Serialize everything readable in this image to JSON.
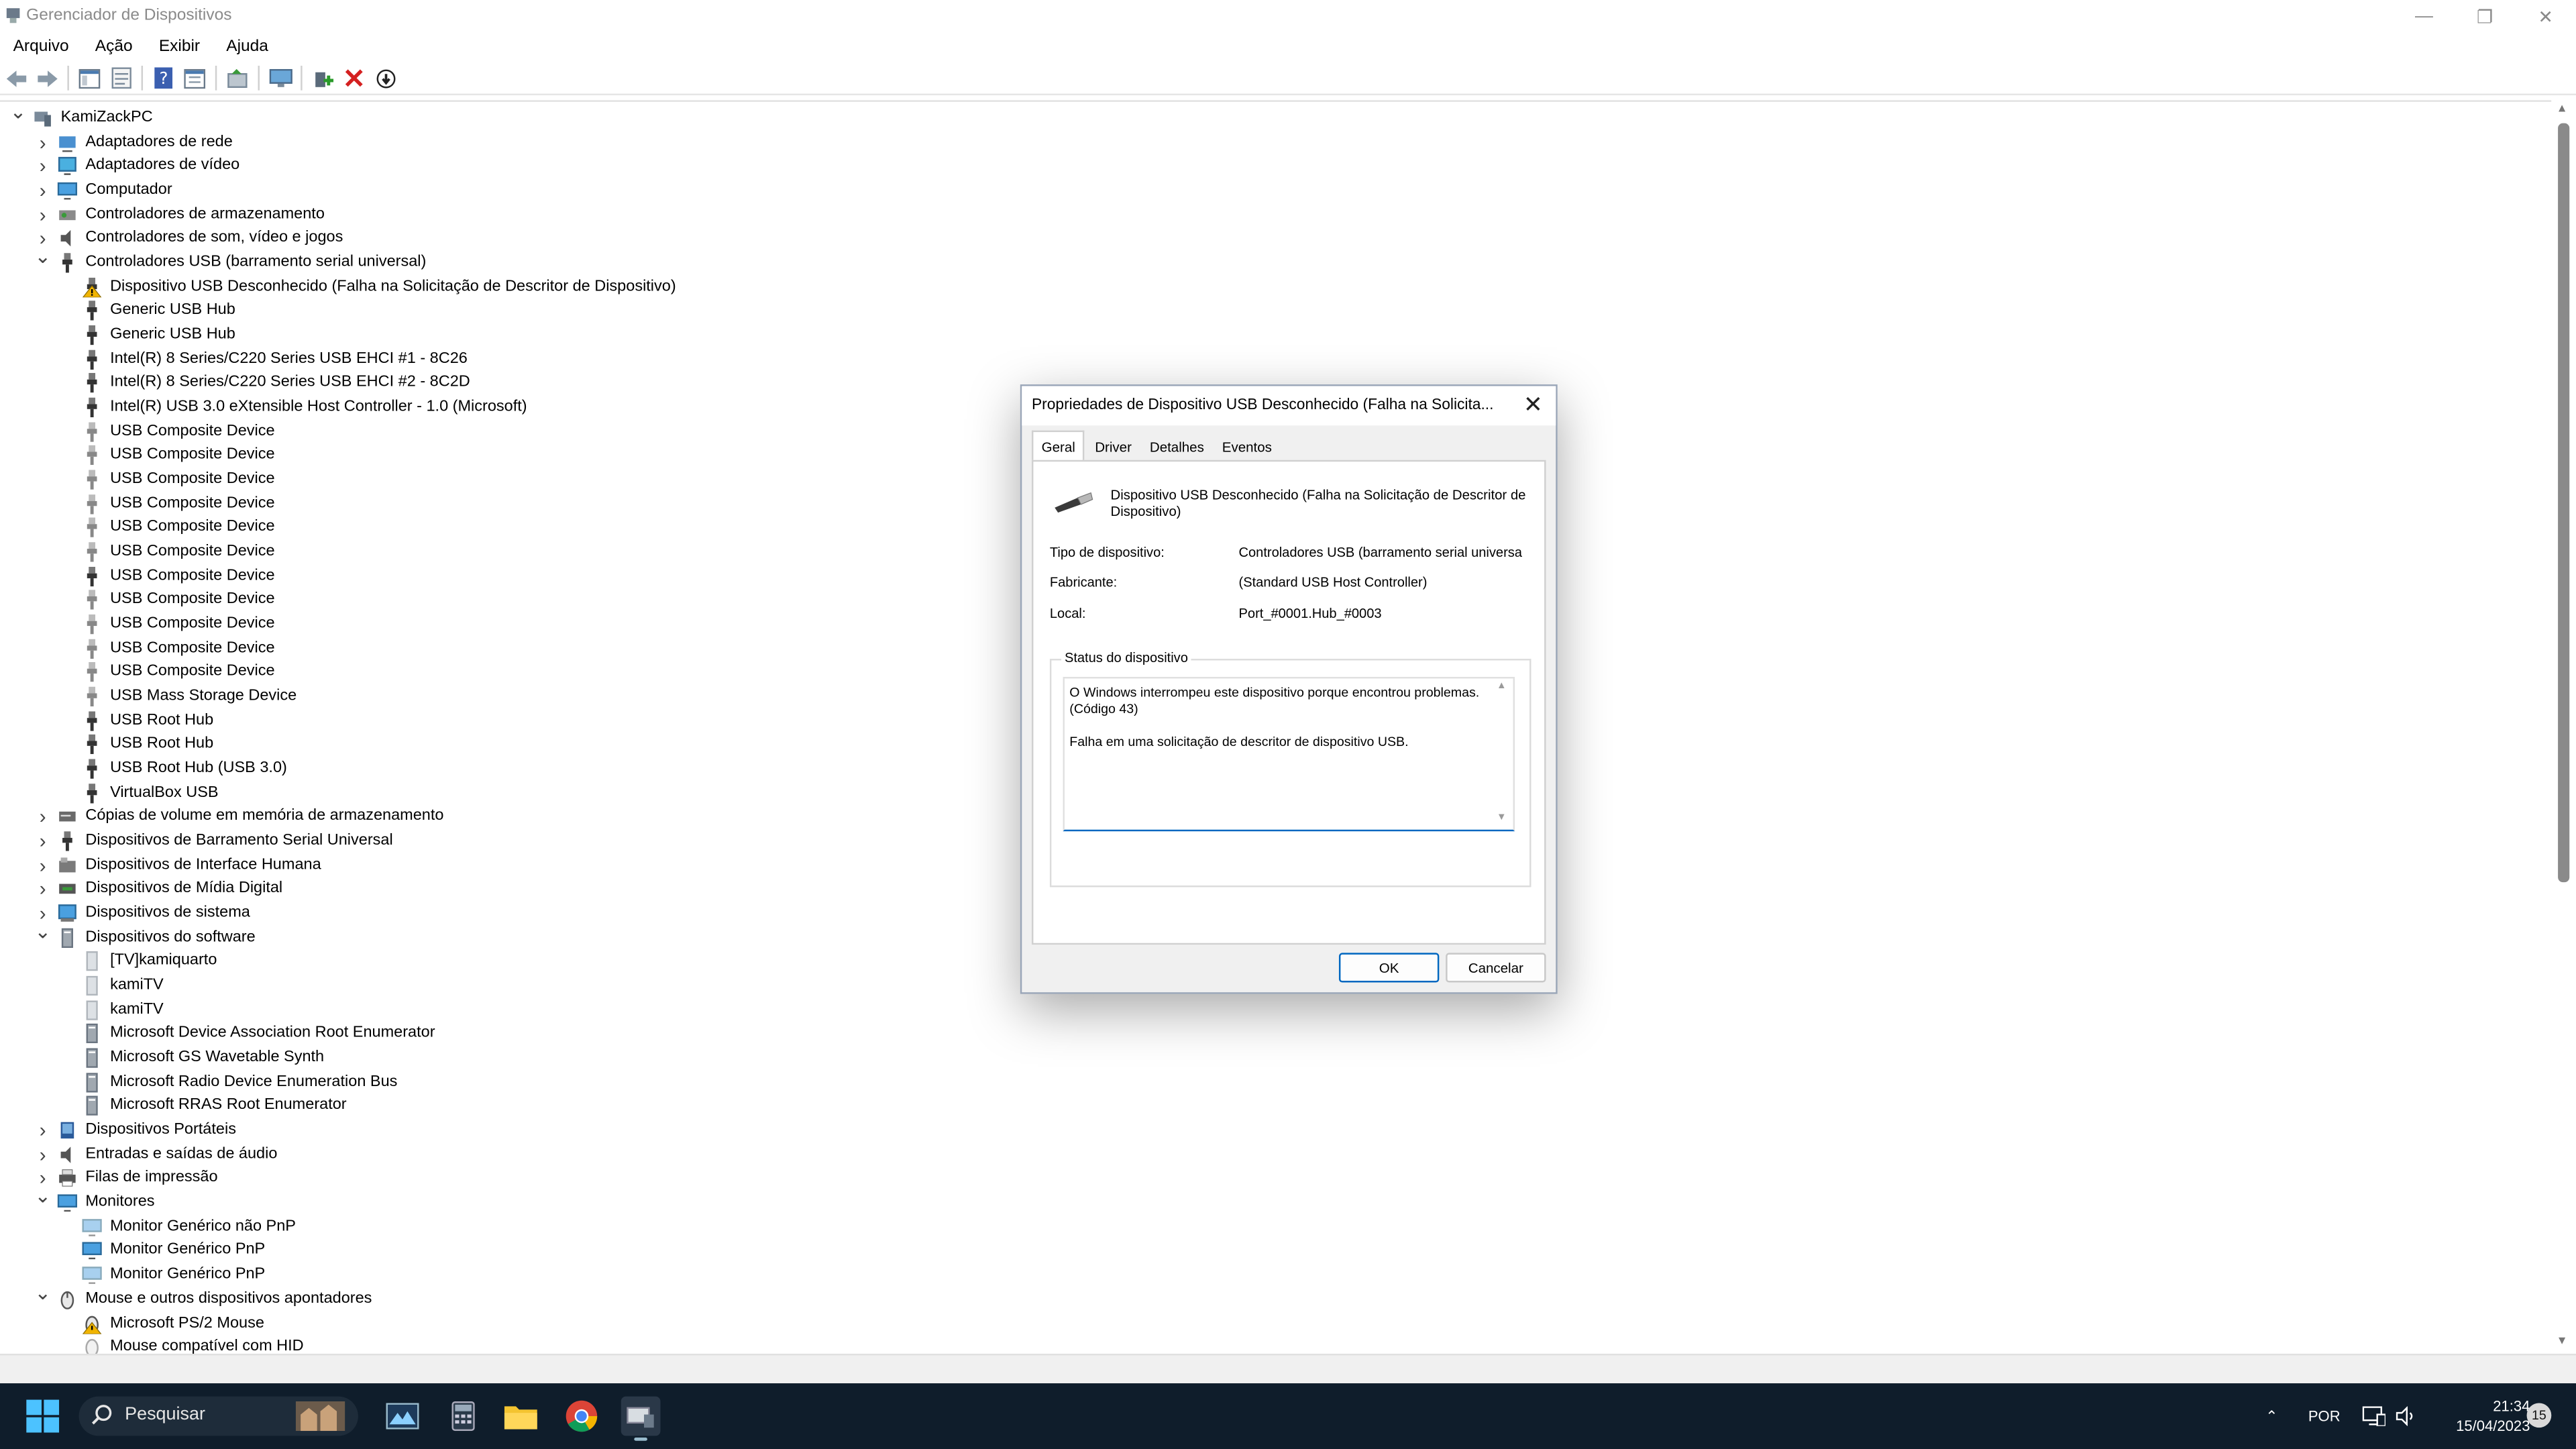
{
  "window": {
    "title": "Gerenciador de Dispositivos"
  },
  "menu": [
    "Arquivo",
    "Ação",
    "Exibir",
    "Ajuda"
  ],
  "tree": [
    {
      "depth": 0,
      "expanded": true,
      "label": "KamiZackPC",
      "icon": "computer-icon"
    },
    {
      "depth": 1,
      "expanded": false,
      "label": "Adaptadores de rede",
      "icon": "network-adapter-icon"
    },
    {
      "depth": 1,
      "expanded": false,
      "label": "Adaptadores de vídeo",
      "icon": "display-adapter-icon"
    },
    {
      "depth": 1,
      "expanded": false,
      "label": "Computador",
      "icon": "monitor-icon"
    },
    {
      "depth": 1,
      "expanded": false,
      "label": "Controladores de armazenamento",
      "icon": "storage-controller-icon"
    },
    {
      "depth": 1,
      "expanded": false,
      "label": "Controladores de som, vídeo e jogos",
      "icon": "speaker-icon"
    },
    {
      "depth": 1,
      "expanded": true,
      "label": "Controladores USB (barramento serial universal)",
      "icon": "usb-icon"
    },
    {
      "depth": 2,
      "label": "Dispositivo USB Desconhecido (Falha na Solicitação de Descritor de Dispositivo)",
      "icon": "usb-warning-icon"
    },
    {
      "depth": 2,
      "label": "Generic USB Hub",
      "icon": "usb-icon"
    },
    {
      "depth": 2,
      "label": "Generic USB Hub",
      "icon": "usb-icon"
    },
    {
      "depth": 2,
      "label": "Intel(R) 8 Series/C220 Series USB EHCI #1 - 8C26",
      "icon": "usb-icon"
    },
    {
      "depth": 2,
      "label": "Intel(R) 8 Series/C220 Series USB EHCI #2 - 8C2D",
      "icon": "usb-icon"
    },
    {
      "depth": 2,
      "label": "Intel(R) USB 3.0 eXtensible Host Controller - 1.0 (Microsoft)",
      "icon": "usb-icon"
    },
    {
      "depth": 2,
      "label": "USB Composite Device",
      "icon": "usb-icon-faded"
    },
    {
      "depth": 2,
      "label": "USB Composite Device",
      "icon": "usb-icon-faded"
    },
    {
      "depth": 2,
      "label": "USB Composite Device",
      "icon": "usb-icon-faded"
    },
    {
      "depth": 2,
      "label": "USB Composite Device",
      "icon": "usb-icon-faded"
    },
    {
      "depth": 2,
      "label": "USB Composite Device",
      "icon": "usb-icon-faded"
    },
    {
      "depth": 2,
      "label": "USB Composite Device",
      "icon": "usb-icon-faded"
    },
    {
      "depth": 2,
      "label": "USB Composite Device",
      "icon": "usb-icon"
    },
    {
      "depth": 2,
      "label": "USB Composite Device",
      "icon": "usb-icon-faded"
    },
    {
      "depth": 2,
      "label": "USB Composite Device",
      "icon": "usb-icon-faded"
    },
    {
      "depth": 2,
      "label": "USB Composite Device",
      "icon": "usb-icon-faded"
    },
    {
      "depth": 2,
      "label": "USB Composite Device",
      "icon": "usb-icon-faded"
    },
    {
      "depth": 2,
      "label": "USB Mass Storage Device",
      "icon": "usb-icon-faded"
    },
    {
      "depth": 2,
      "label": "USB Root Hub",
      "icon": "usb-icon"
    },
    {
      "depth": 2,
      "label": "USB Root Hub",
      "icon": "usb-icon"
    },
    {
      "depth": 2,
      "label": "USB Root Hub (USB 3.0)",
      "icon": "usb-icon"
    },
    {
      "depth": 2,
      "label": "VirtualBox USB",
      "icon": "usb-icon"
    },
    {
      "depth": 1,
      "expanded": false,
      "label": "Cópias de volume em memória de armazenamento",
      "icon": "storage-volume-icon"
    },
    {
      "depth": 1,
      "expanded": false,
      "label": "Dispositivos de Barramento Serial Universal",
      "icon": "usb-icon"
    },
    {
      "depth": 1,
      "expanded": false,
      "label": "Dispositivos de Interface Humana",
      "icon": "hid-icon"
    },
    {
      "depth": 1,
      "expanded": false,
      "label": "Dispositivos de Mídia Digital",
      "icon": "media-device-icon"
    },
    {
      "depth": 1,
      "expanded": false,
      "label": "Dispositivos de sistema",
      "icon": "system-device-icon"
    },
    {
      "depth": 1,
      "expanded": true,
      "label": "Dispositivos do software",
      "icon": "software-device-icon"
    },
    {
      "depth": 2,
      "label": "[TV]kamiquarto",
      "icon": "software-device-icon-faded"
    },
    {
      "depth": 2,
      "label": "kamiTV",
      "icon": "software-device-icon-faded"
    },
    {
      "depth": 2,
      "label": "kamiTV",
      "icon": "software-device-icon-faded"
    },
    {
      "depth": 2,
      "label": "Microsoft Device Association Root Enumerator",
      "icon": "software-device-icon"
    },
    {
      "depth": 2,
      "label": "Microsoft GS Wavetable Synth",
      "icon": "software-device-icon"
    },
    {
      "depth": 2,
      "label": "Microsoft Radio Device Enumeration Bus",
      "icon": "software-device-icon"
    },
    {
      "depth": 2,
      "label": "Microsoft RRAS Root Enumerator",
      "icon": "software-device-icon"
    },
    {
      "depth": 1,
      "expanded": false,
      "label": "Dispositivos Portáteis",
      "icon": "portable-device-icon"
    },
    {
      "depth": 1,
      "expanded": false,
      "label": "Entradas e saídas de áudio",
      "icon": "speaker-icon"
    },
    {
      "depth": 1,
      "expanded": false,
      "label": "Filas de impressão",
      "icon": "printer-icon"
    },
    {
      "depth": 1,
      "expanded": true,
      "label": "Monitores",
      "icon": "monitor-icon"
    },
    {
      "depth": 2,
      "label": "Monitor Genérico não PnP",
      "icon": "monitor-icon-faded"
    },
    {
      "depth": 2,
      "label": "Monitor Genérico PnP",
      "icon": "monitor-icon"
    },
    {
      "depth": 2,
      "label": "Monitor Genérico PnP",
      "icon": "monitor-icon-faded"
    },
    {
      "depth": 1,
      "expanded": true,
      "label": "Mouse e outros dispositivos apontadores",
      "icon": "mouse-icon"
    },
    {
      "depth": 2,
      "label": "Microsoft PS/2 Mouse",
      "icon": "mouse-warning-icon"
    },
    {
      "depth": 2,
      "label": "Mouse compatível com HID",
      "icon": "mouse-icon-faded"
    }
  ],
  "dialog": {
    "title": "Propriedades de Dispositivo USB Desconhecido (Falha na Solicita...",
    "tabs": [
      "Geral",
      "Driver",
      "Detalhes",
      "Eventos"
    ],
    "active_tab": "Geral",
    "device_name": "Dispositivo USB Desconhecido (Falha na Solicitação de Descritor de Dispositivo)",
    "props": {
      "type_label": "Tipo de dispositivo:",
      "type_value": "Controladores USB (barramento serial universa",
      "maker_label": "Fabricante:",
      "maker_value": "(Standard USB Host Controller)",
      "location_label": "Local:",
      "location_value": "Port_#0001.Hub_#0003"
    },
    "status_group_label": "Status do dispositivo",
    "status_text": "O Windows interrompeu este dispositivo porque encontrou problemas. (Código 43)\n\nFalha em uma solicitação de descritor de dispositivo USB.",
    "ok_label": "OK",
    "cancel_label": "Cancelar"
  },
  "taskbar": {
    "search_placeholder": "Pesquisar",
    "language": "POR",
    "time": "21:34",
    "date": "15/04/2023",
    "notification_count": "15"
  },
  "colors": {
    "accent": "#0067c0",
    "taskbar": "#0f1d2b",
    "warning": "#f0b400",
    "delete": "#d42020"
  }
}
